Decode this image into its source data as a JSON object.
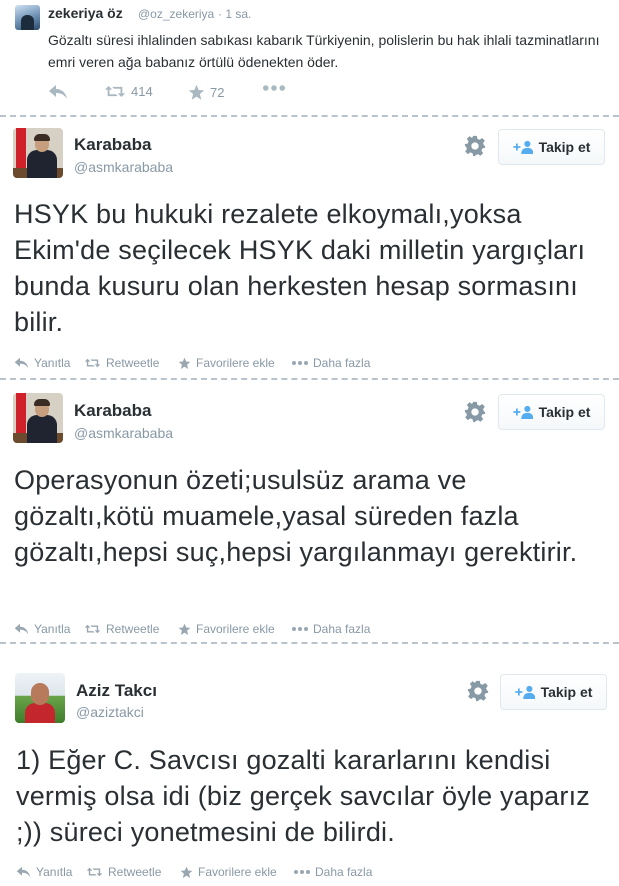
{
  "compact_tweet": {
    "name": "zekeriya öz",
    "handle": "@oz_zekeriya",
    "time": "· 1 sa.",
    "text": "Gözaltı süresi ihlalinden sabıkası kabarık Türkiyenin, polislerin bu hak ihlali tazminatlarını emri veren ağa babanız örtülü ödenekten öder.",
    "retweets": "414",
    "favorites": "72"
  },
  "tweets": [
    {
      "name": "Karababa",
      "handle": "@asmkarababa",
      "follow_label": "Takip et",
      "text": "HSYK bu hukuki rezalete elkoymalı,yoksa Ekim'de seçilecek HSYK daki milletin yargıçları bunda kusuru olan herkesten hesap sormasını bilir."
    },
    {
      "name": "Karababa",
      "handle": "@asmkarababa",
      "follow_label": "Takip et",
      "text": "Operasyonun özeti;usulsüz arama ve gözaltı,kötü muamele,yasal süreden fazla gözaltı,hepsi suç,hepsi yargılanmayı gerektirir."
    },
    {
      "name": "Aziz Takcı",
      "handle": "@aziztakci",
      "follow_label": "Takip et",
      "text": "1) Eğer C. Savcısı gozalti kararlarını kendisi vermiş olsa idi (biz gerçek savcılar öyle yaparız ;)) süreci yonetmesini de bilirdi."
    }
  ],
  "actions": {
    "reply": "Yanıtla",
    "retweet": "Retweetle",
    "favorite": "Favorilere ekle",
    "more": "Daha fazla"
  },
  "icons": {
    "reply": "reply-icon",
    "retweet": "retweet-icon",
    "favorite": "star-icon",
    "more": "more-dots-icon",
    "gear": "gear-icon",
    "follow": "add-user-icon"
  }
}
